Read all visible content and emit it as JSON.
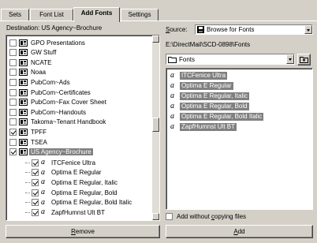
{
  "tabs": [
    {
      "label": "Sets"
    },
    {
      "label": "Font List"
    },
    {
      "label": "Add Fonts"
    },
    {
      "label": "Settings"
    }
  ],
  "destination": {
    "label": "Destination: US Agency~Brochure",
    "items": [
      {
        "label": "GPO Presentations",
        "checked": false
      },
      {
        "label": "GW Stuff",
        "checked": false
      },
      {
        "label": "NCATE",
        "checked": false
      },
      {
        "label": "Noaa",
        "checked": false
      },
      {
        "label": "PubCom~Ads",
        "checked": false
      },
      {
        "label": "PubCom~Certificates",
        "checked": false
      },
      {
        "label": "PubCom~Fax Cover Sheet",
        "checked": false
      },
      {
        "label": "PubCom~Handouts",
        "checked": false
      },
      {
        "label": "Takoma~Tenant Handbook",
        "checked": false
      },
      {
        "label": "TPFF",
        "checked": true
      },
      {
        "label": "TSEA",
        "checked": false
      },
      {
        "label": "US Agency~Brochure",
        "checked": true,
        "selected": true
      }
    ],
    "children": [
      {
        "label": "ITCFenice Ultra",
        "checked": true
      },
      {
        "label": "Optima E Regular",
        "checked": true
      },
      {
        "label": "Optima E Regular, Italic",
        "checked": true
      },
      {
        "label": "Optima E Regular, Bold",
        "checked": true
      },
      {
        "label": "Optima E Regular, Bold Italic",
        "checked": true
      },
      {
        "label": "ZapfHumnst Ult BT",
        "checked": true
      }
    ]
  },
  "source": {
    "label": "Source:",
    "value": "Browse for Fonts",
    "path": "E:\\DirectMail\\SCD-0898\\Fonts",
    "folder": "Fonts",
    "fonts": [
      "ITCFenice Ultra",
      "Optima E Regular",
      "Optima E Regular, Italic",
      "Optima E Regular, Bold",
      "Optima E Regular, Bold Italic",
      "ZapfHumnst Ult BT"
    ],
    "copy_checkbox": {
      "label": "Add without copying files",
      "checked": false
    }
  },
  "buttons": {
    "remove": "Remove",
    "add": "Add"
  },
  "icons": {
    "font_glyph": "a"
  }
}
